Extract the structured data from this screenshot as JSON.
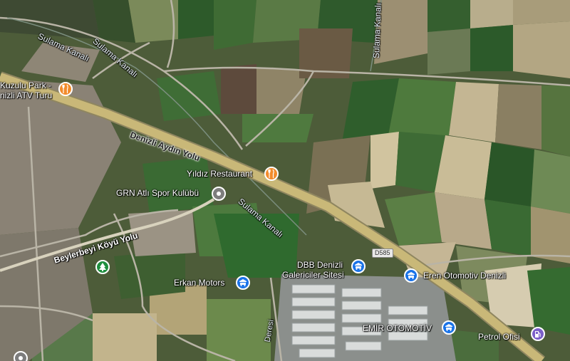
{
  "colors": {
    "restaurant_pin": "#f28b2b",
    "business_pin": "#1a73e8",
    "park_pin": "#1e8e3e",
    "club_pin": "#7d7d7d",
    "fuel_pin": "#7b5fc9",
    "highway": "#c9b878"
  },
  "labels": {
    "highway": "Denizli Aydın Yolu",
    "secondary_road": "Beylerbeyi Köyü Yolu",
    "canal_1": "Sulama Kanalı",
    "canal_2": "Sulama Kanalı",
    "canal_3": "Sulama Kanalı",
    "canal_4": "Sulama Kanalı",
    "route_shield": "D585",
    "dere": "Deresi"
  },
  "places": {
    "kuzulu_line1": "Kuzulu Park -",
    "kuzulu_line2": "nizli ATV Turu",
    "yildiz": "Yıldız Restaurant",
    "grn": "GRN Atlı Spor Kulübü",
    "dbb_line1": "DBB Denizli",
    "dbb_line2": "Galericiler Sitesi",
    "eren": "Eren Otomotiv Denizli",
    "erkan": "Erkan Motors",
    "emir": "EMİR OTOMOTİV",
    "petrol": "Petrol Ofisi"
  },
  "icons": {
    "restaurant": "fork-knife-icon",
    "business": "car-dealer-icon",
    "park": "tree-icon",
    "club": "dot-pin-icon",
    "fuel": "fuel-pump-icon"
  }
}
